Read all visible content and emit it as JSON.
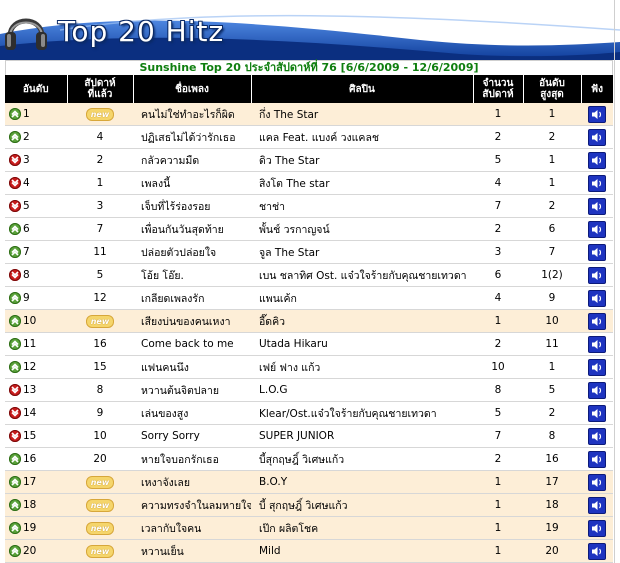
{
  "banner": {
    "title": "Top 20 Hitz"
  },
  "chart": {
    "subtitle": "Sunshine Top 20 ประจำสัปดาห์ที่ 76 [6/6/2009 - 12/6/2009]",
    "headers": {
      "rank": "อันดับ",
      "last_week_1": "สัปดาห์",
      "last_week_2": "ที่แล้ว",
      "song": "ชื่อเพลง",
      "artist": "ศิลปิน",
      "weeks_1": "จำนวน",
      "weeks_2": "สัปดาห์",
      "peak_1": "อันดับ",
      "peak_2": "สูงสุด",
      "listen": "ฟัง"
    },
    "new_label": "new",
    "rows": [
      {
        "rank": "1",
        "dir": "up",
        "last": "new",
        "song": "คนไม่ใช่ทำอะไรก็ผิด",
        "artist": "กึ่ง The Star",
        "weeks": "1",
        "peak": "1"
      },
      {
        "rank": "2",
        "dir": "up",
        "last": "4",
        "song": "ปฏิเสธไม่ได้ว่ารักเธอ",
        "artist": "แคล Feat. แบงค์ วงแคลช",
        "weeks": "2",
        "peak": "2"
      },
      {
        "rank": "3",
        "dir": "down",
        "last": "2",
        "song": "กลัวความมืด",
        "artist": "ดิว The Star",
        "weeks": "5",
        "peak": "1"
      },
      {
        "rank": "4",
        "dir": "down",
        "last": "1",
        "song": "เพลงนี้",
        "artist": "สิงโต The star",
        "weeks": "4",
        "peak": "1"
      },
      {
        "rank": "5",
        "dir": "down",
        "last": "3",
        "song": "เจ็บที่ไร้ร่องรอย",
        "artist": "ชาช่า",
        "weeks": "7",
        "peak": "2"
      },
      {
        "rank": "6",
        "dir": "up",
        "last": "7",
        "song": "เพื่อนกันวันสุดท้าย",
        "artist": "พั้นช์ วรกาญจน์",
        "weeks": "2",
        "peak": "6"
      },
      {
        "rank": "7",
        "dir": "up",
        "last": "11",
        "song": "ปล่อยตัวปล่อยใจ",
        "artist": "จูล The Star",
        "weeks": "3",
        "peak": "7"
      },
      {
        "rank": "8",
        "dir": "down",
        "last": "5",
        "song": "โอ้ย โอ๊ย.",
        "artist": "เบน ชลาทิศ Ost. แจ๋วใจร้ายกับคุณชายเทวดา",
        "weeks": "6",
        "peak": "1(2)"
      },
      {
        "rank": "9",
        "dir": "up",
        "last": "12",
        "song": "เกลียดเพลงรัก",
        "artist": "แพนเค้ก",
        "weeks": "4",
        "peak": "9"
      },
      {
        "rank": "10",
        "dir": "up",
        "last": "new",
        "song": "เสียงบ่นของคนเหงา",
        "artist": "อี๊ดคิว",
        "weeks": "1",
        "peak": "10"
      },
      {
        "rank": "11",
        "dir": "up",
        "last": "16",
        "song": "Come back to me",
        "artist": "Utada Hikaru",
        "weeks": "2",
        "peak": "11"
      },
      {
        "rank": "12",
        "dir": "up",
        "last": "15",
        "song": "แฟนคนนึง",
        "artist": "เฟย์ ฟาง แก้ว",
        "weeks": "10",
        "peak": "1"
      },
      {
        "rank": "13",
        "dir": "down",
        "last": "8",
        "song": "หวานต้นจิตปลาย",
        "artist": "L.O.G",
        "weeks": "8",
        "peak": "5"
      },
      {
        "rank": "14",
        "dir": "down",
        "last": "9",
        "song": "เล่นของสูง",
        "artist": "Klear/Ost.แจ๋วใจร้ายกับคุณชายเทวดา",
        "weeks": "5",
        "peak": "2"
      },
      {
        "rank": "15",
        "dir": "down",
        "last": "10",
        "song": "Sorry Sorry",
        "artist": "SUPER JUNIOR",
        "weeks": "7",
        "peak": "8"
      },
      {
        "rank": "16",
        "dir": "up",
        "last": "20",
        "song": "หายใจบอกรักเธอ",
        "artist": "บี้สุกฤษฎิ์ วิเศษแก้ว",
        "weeks": "2",
        "peak": "16"
      },
      {
        "rank": "17",
        "dir": "up",
        "last": "new",
        "song": "เหงาจังเลย",
        "artist": "B.O.Y",
        "weeks": "1",
        "peak": "17"
      },
      {
        "rank": "18",
        "dir": "up",
        "last": "new",
        "song": "ความทรงจำในลมหายใจ",
        "artist": "บี้ สุกฤษฎิ์ วิเศษแก้ว",
        "weeks": "1",
        "peak": "18"
      },
      {
        "rank": "19",
        "dir": "up",
        "last": "new",
        "song": "เวลากับใจคน",
        "artist": "เป๊ก ผลิตโชค",
        "weeks": "1",
        "peak": "19"
      },
      {
        "rank": "20",
        "dir": "up",
        "last": "new",
        "song": "หวานเย็น",
        "artist": "Mild",
        "weeks": "1",
        "peak": "20"
      }
    ]
  },
  "colors": {
    "header_bg": "#000000",
    "subtitle": "#0f7f0f",
    "highlight_row": "#fdeed7",
    "up_arrow": "#5aa23a",
    "down_arrow": "#c91c1c",
    "speaker": "#1e34c0"
  },
  "icons": {
    "up": "arrow-up-icon",
    "down": "arrow-down-icon",
    "listen": "speaker-icon",
    "logo": "headphones-icon"
  }
}
